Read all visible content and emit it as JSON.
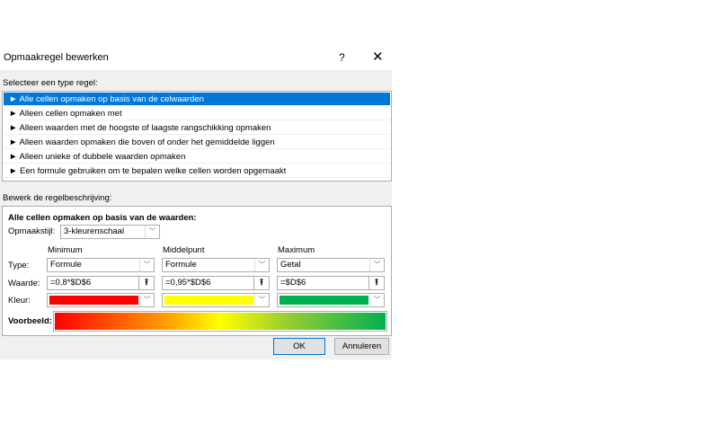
{
  "dialog": {
    "title": "Opmaakregel bewerken",
    "help": "?",
    "close": "✕"
  },
  "rule_type": {
    "label": "Selecteer een type regel:",
    "items": [
      "► Alle cellen opmaken op basis van de celwaarden",
      "► Alleen cellen opmaken met",
      "► Alleen waarden met de hoogste of laagste rangschikking opmaken",
      "► Alleen waarden opmaken die boven of onder het gemiddelde liggen",
      "► Alleen unieke of dubbele waarden opmaken",
      "► Een formule gebruiken om te bepalen welke cellen worden opgemaakt"
    ]
  },
  "description": {
    "label": "Bewerk de regelbeschrijving:",
    "heading": "Alle cellen opmaken op basis van de waarden:",
    "style_label": "Opmaakstijl:",
    "style_value": "3-kleurenschaal",
    "type_label": "Type:",
    "value_label": "Waarde:",
    "color_label": "Kleur:",
    "preview_label": "Voorbeeld:",
    "columns": [
      {
        "header": "Minimum",
        "type": "Formule",
        "value": "=0,8*$D$6",
        "color": "#ff0000"
      },
      {
        "header": "Middelpunt",
        "type": "Formule",
        "value": "=0,95*$D$6",
        "color": "#ffff00"
      },
      {
        "header": "Maximum",
        "type": "Getal",
        "value": "=$D$6",
        "color": "#00b050"
      }
    ]
  },
  "buttons": {
    "ok": "OK",
    "cancel": "Annuleren"
  }
}
